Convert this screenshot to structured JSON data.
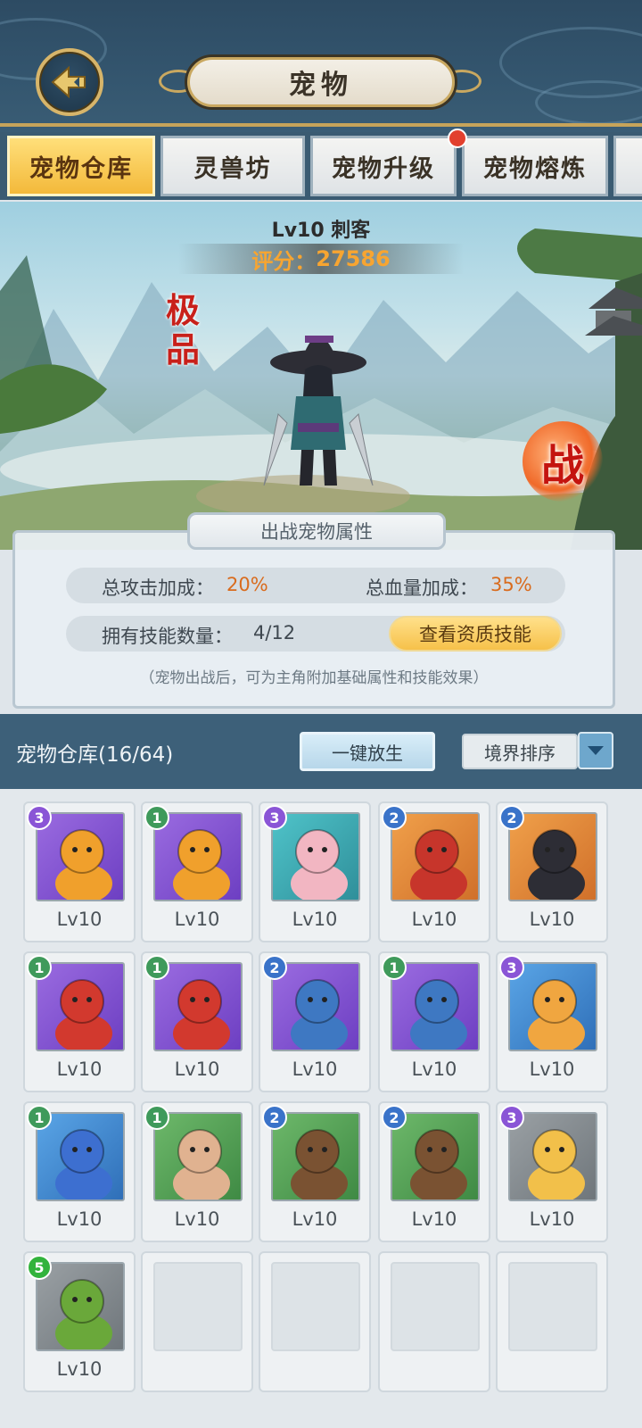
{
  "header": {
    "title": "宠物"
  },
  "tabs": [
    {
      "label": "宠物仓库",
      "active": true
    },
    {
      "label": "灵兽坊",
      "active": false
    },
    {
      "label": "宠物升级",
      "active": false,
      "has_dot": true
    },
    {
      "label": "宠物熔炼",
      "active": false
    }
  ],
  "pet": {
    "name": "Lv10 刺客",
    "score_label": "评分：",
    "score": "27586",
    "quality": "极品",
    "fight_label": "战"
  },
  "attributes": {
    "title": "出战宠物属性",
    "attack_label": "总攻击加成：",
    "attack_value": "20%",
    "hp_label": "总血量加成：",
    "hp_value": "35%",
    "skills_label": "拥有技能数量：",
    "skills_value": "4/12",
    "skill_button": "查看资质技能",
    "note": "（宠物出战后，可为主角附加基础属性和技能效果）"
  },
  "storage": {
    "title": "宠物仓库(16/64)",
    "release_button": "一键放生",
    "sort_label": "境界排序"
  },
  "colors": {
    "purple": "#8a55d6",
    "green": "#3f9a5b",
    "blue": "#3a73c9",
    "bright_green": "#32b33c",
    "orange": "#e08a2c"
  },
  "pets": [
    {
      "stars": "3",
      "level": "Lv10",
      "icon": "golden-dragon-icon",
      "frame": "purple"
    },
    {
      "stars": "1",
      "level": "Lv10",
      "icon": "golden-dragon-icon",
      "frame": "purple"
    },
    {
      "stars": "3",
      "level": "Lv10",
      "icon": "flower-girl-icon",
      "frame": "teal"
    },
    {
      "stars": "2",
      "level": "Lv10",
      "icon": "fox-girl-icon",
      "frame": "orange"
    },
    {
      "stars": "2",
      "level": "Lv10",
      "icon": "assassin-icon",
      "frame": "orange"
    },
    {
      "stars": "1",
      "level": "Lv10",
      "icon": "red-horse-warrior-icon",
      "frame": "purple"
    },
    {
      "stars": "1",
      "level": "Lv10",
      "icon": "red-horse-warrior-icon",
      "frame": "purple"
    },
    {
      "stars": "2",
      "level": "Lv10",
      "icon": "blue-bull-warrior-icon",
      "frame": "purple"
    },
    {
      "stars": "1",
      "level": "Lv10",
      "icon": "blue-bull-warrior-icon",
      "frame": "purple"
    },
    {
      "stars": "3",
      "level": "Lv10",
      "icon": "tiger-icon",
      "frame": "blue"
    },
    {
      "stars": "1",
      "level": "Lv10",
      "icon": "wolf-icon",
      "frame": "blue"
    },
    {
      "stars": "1",
      "level": "Lv10",
      "icon": "bandit-icon",
      "frame": "green"
    },
    {
      "stars": "2",
      "level": "Lv10",
      "icon": "treant-icon",
      "frame": "green"
    },
    {
      "stars": "2",
      "level": "Lv10",
      "icon": "treant-icon",
      "frame": "green"
    },
    {
      "stars": "3",
      "level": "Lv10",
      "icon": "serpent-icon",
      "frame": "gray"
    },
    {
      "stars": "5",
      "level": "Lv10",
      "icon": "turtle-icon",
      "frame": "gray"
    }
  ]
}
